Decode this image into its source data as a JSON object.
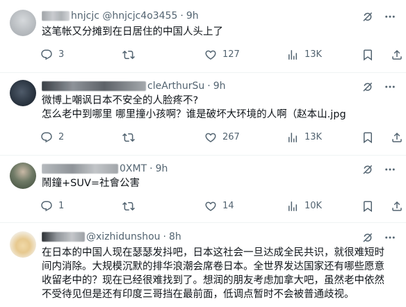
{
  "tweets": [
    {
      "name": "",
      "handle": "@hnjcjc4o3455",
      "handle_visible": "hnjcjc @hnjcjc4o3455",
      "time": "9h",
      "lines": [
        "这笔帐又分摊到在日居住的中国人头上了"
      ],
      "stats": {
        "replies": "3",
        "retweets": "",
        "likes": "127",
        "views": "13K"
      }
    },
    {
      "name": "",
      "handle": "cleArthurSu",
      "time": "9h",
      "lines": [
        "微博上嘲讽日本不安全的人脸疼不?",
        "怎么老中到哪里 哪里撞小孩啊？谁是破坏大环境的人啊（赵本山.jpg"
      ],
      "stats": {
        "replies": "2",
        "retweets": "",
        "likes": "267",
        "views": "13K"
      }
    },
    {
      "name": "",
      "handle": "0XMT",
      "time": "9h",
      "lines": [
        "鬧鐘+SUV=社會公害"
      ],
      "stats": {
        "replies": "1",
        "retweets": "",
        "likes": "14",
        "views": "10K"
      }
    },
    {
      "name": "",
      "handle": "@xizhidunshou",
      "time": "8h",
      "lines": [
        "在日本的中国人现在瑟瑟发抖吧，日本这社会一旦达成全民共识，就很难短时",
        "间内消除。大规模沉默的排华浪潮会席卷日本。全世界发达国家还有哪些愿意",
        "收留老中的？现在已经很难找到了。想润的朋友考虑加拿大吧，虽然老中依然",
        "不受待见但是还有印度三哥挡在最前面，低调点暂时不会被普通歧视。"
      ]
    }
  ],
  "icons": {
    "reply": "reply-icon",
    "retweet": "retweet-icon",
    "like": "like-icon",
    "views": "views-icon",
    "bookmark": "bookmark-icon",
    "share": "share-icon",
    "grok": "grok-icon",
    "more": "more-icon"
  },
  "colors": {
    "text": "#0f1419",
    "secondary": "#536471",
    "divider": "#eff3f4"
  }
}
